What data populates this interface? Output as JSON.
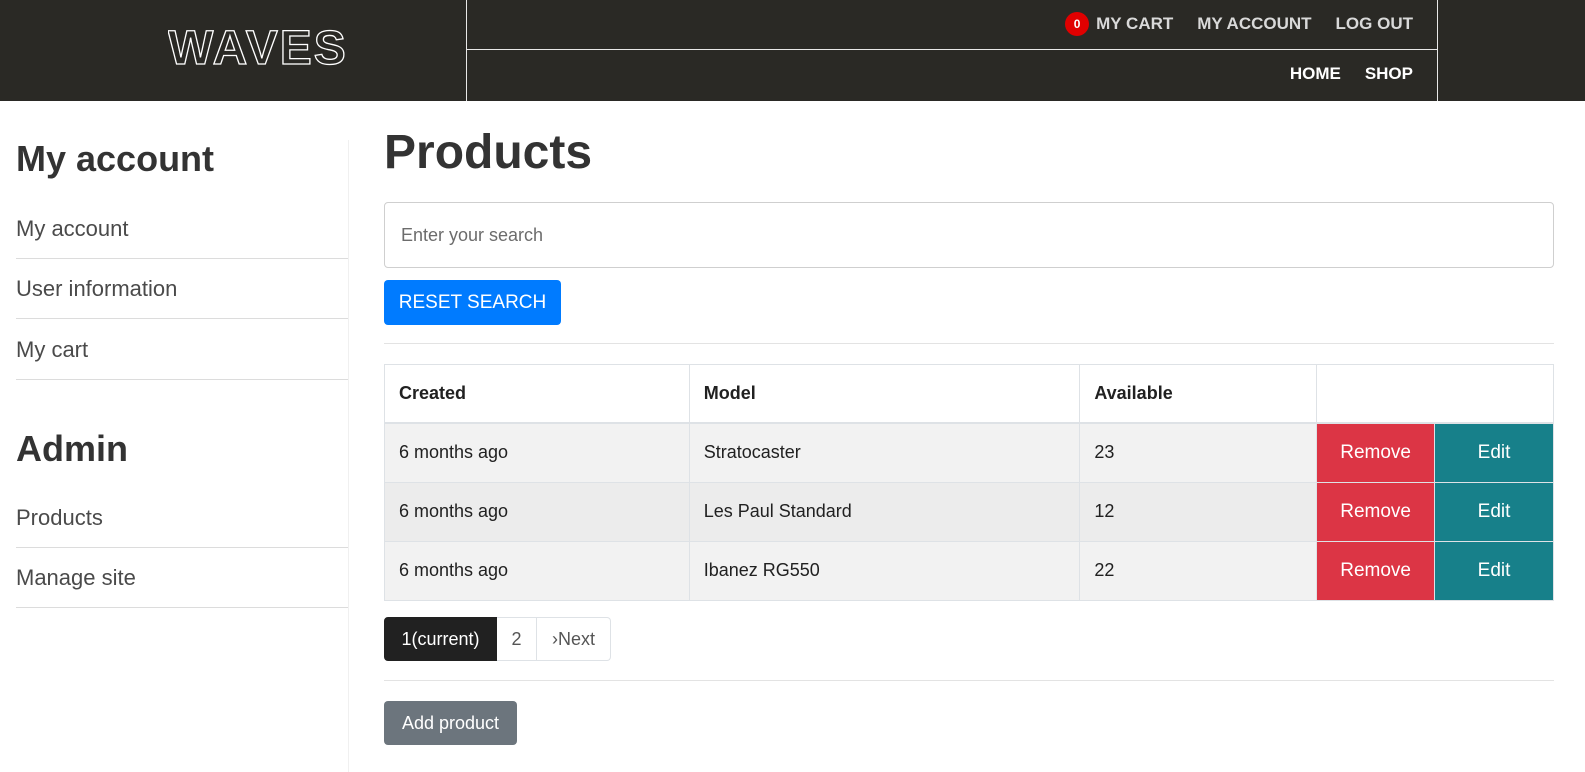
{
  "header": {
    "logo_text": "WAVES",
    "cart_count": "0",
    "cart_label": "MY CART",
    "account_label": "MY ACCOUNT",
    "logout_label": "LOG OUT",
    "home_label": "HOME",
    "shop_label": "SHOP"
  },
  "sidebar": {
    "account_heading": "My account",
    "account_items": [
      {
        "label": "My account"
      },
      {
        "label": "User information"
      },
      {
        "label": "My cart"
      }
    ],
    "admin_heading": "Admin",
    "admin_items": [
      {
        "label": "Products"
      },
      {
        "label": "Manage site"
      }
    ]
  },
  "main": {
    "title": "Products",
    "search_placeholder": "Enter your search",
    "reset_label": "RESET SEARCH",
    "table": {
      "headers": [
        "Created",
        "Model",
        "Available",
        ""
      ],
      "rows": [
        {
          "created": "6 months ago",
          "model": "Stratocaster",
          "available": "23"
        },
        {
          "created": "6 months ago",
          "model": "Les Paul Standard",
          "available": "12"
        },
        {
          "created": "6 months ago",
          "model": "Ibanez RG550",
          "available": "22"
        }
      ],
      "remove_label": "Remove",
      "edit_label": "Edit"
    },
    "pagination": {
      "current": "1(current)",
      "page2": "2",
      "next": "›Next"
    },
    "add_label": "Add product"
  },
  "colors": {
    "header_bg": "#2a2925",
    "primary": "#007bff",
    "danger": "#dc3545",
    "edit": "#17808a",
    "cart_badge": "#e00000"
  }
}
